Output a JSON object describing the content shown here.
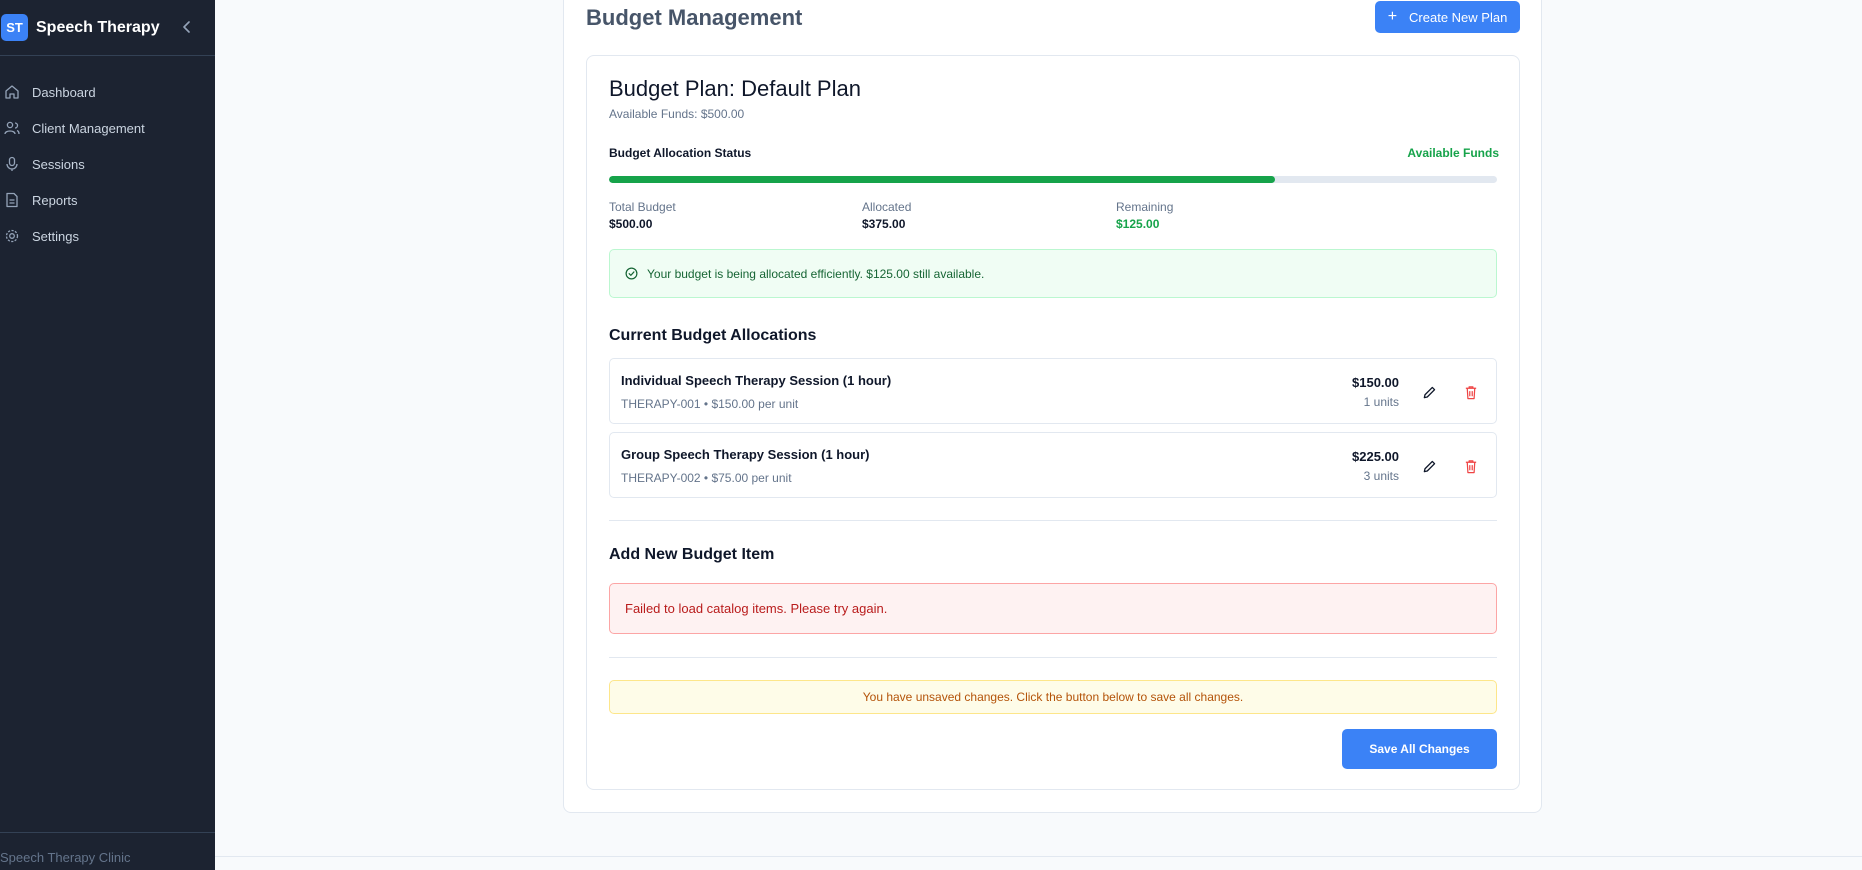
{
  "sidebar": {
    "logo_text": "ST",
    "app_title": "Speech Therapy",
    "items": [
      {
        "label": "Dashboard",
        "icon": "home-icon"
      },
      {
        "label": "Client Management",
        "icon": "users-icon"
      },
      {
        "label": "Sessions",
        "icon": "microphone-icon"
      },
      {
        "label": "Reports",
        "icon": "document-icon"
      },
      {
        "label": "Settings",
        "icon": "gear-icon"
      }
    ],
    "footer": "Speech Therapy Clinic"
  },
  "header": {
    "title": "Budget Management",
    "create_button": "Create New Plan"
  },
  "plan": {
    "title": "Budget Plan: Default Plan",
    "subtitle": "Available Funds: $500.00",
    "status_label": "Budget Allocation Status",
    "status_right": "Available Funds",
    "allocated_fraction": 0.75,
    "stats": {
      "total_label": "Total Budget",
      "total_value": "$500.00",
      "allocated_label": "Allocated",
      "allocated_value": "$375.00",
      "remaining_label": "Remaining",
      "remaining_value": "$125.00"
    },
    "success_message": "Your budget is being allocated efficiently. $125.00 still available."
  },
  "allocations": {
    "title": "Current Budget Allocations",
    "items": [
      {
        "name": "Individual Speech Therapy Session (1 hour)",
        "meta": "THERAPY-001 • $150.00 per unit",
        "amount": "$150.00",
        "units": "1 units"
      },
      {
        "name": "Group Speech Therapy Session (1 hour)",
        "meta": "THERAPY-002 • $75.00 per unit",
        "amount": "$225.00",
        "units": "3 units"
      }
    ]
  },
  "add_item": {
    "title": "Add New Budget Item",
    "error": "Failed to load catalog items. Please try again."
  },
  "footer_actions": {
    "warning": "You have unsaved changes. Click the button below to save all changes.",
    "save_button": "Save All Changes"
  },
  "colors": {
    "sidebar_bg": "#1c2331",
    "accent": "#3b82f6",
    "success": "#16a34a",
    "error": "#b91c1c",
    "warning": "#b45309"
  }
}
